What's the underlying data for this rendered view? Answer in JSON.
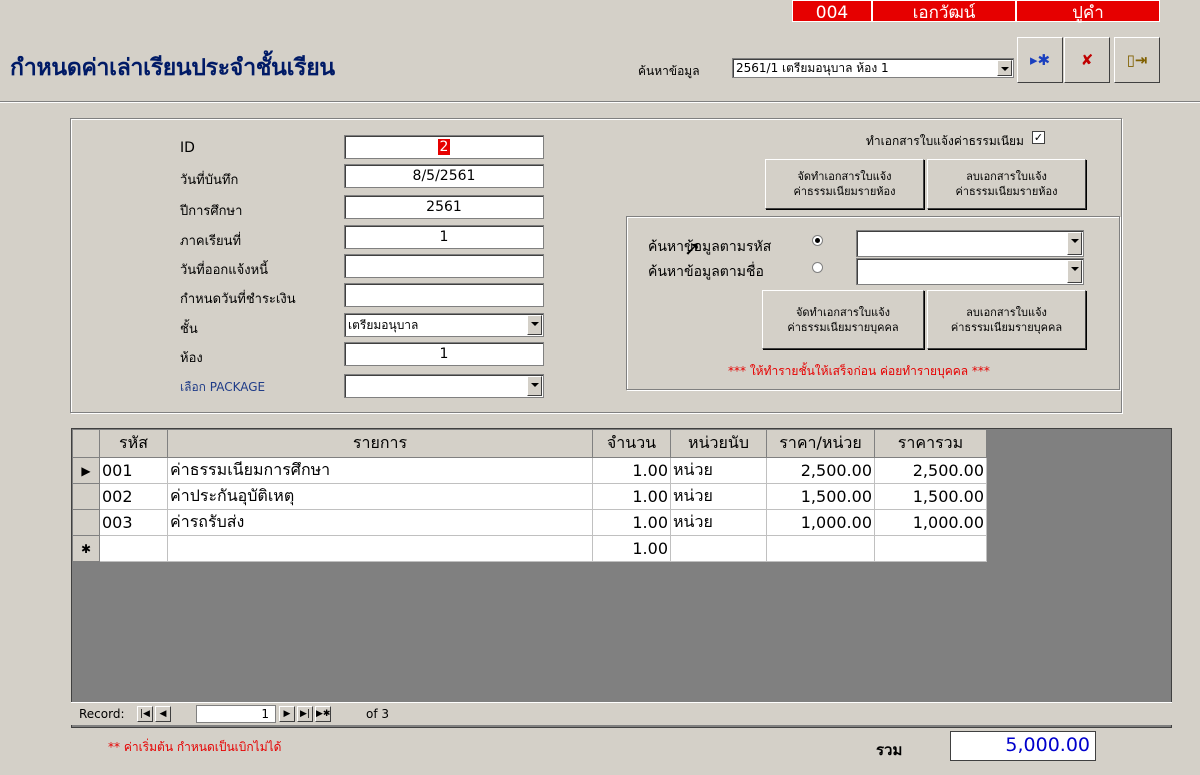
{
  "user_bar": {
    "code": "004",
    "first_name": "เอกวัฒน์",
    "last_name": "ปูคำ"
  },
  "page_title": "กำหนดค่าเล่าเรียนประจำชั้นเรียน",
  "search": {
    "label": "ค้นหาข้อมูล",
    "value": "2561/1 เตรียมอนุบาล  ห้อง  1"
  },
  "form": {
    "labels": {
      "id": "ID",
      "record_date": "วันที่บันทึก",
      "academic_year": "ปีการศึกษา",
      "semester": "ภาคเรียนที่",
      "issue_date": "วันที่ออกแจ้งหนี้",
      "due_date": "กำหนดวันที่ชำระเงิน",
      "level": "ชั้น",
      "room": "ห้อง",
      "package": "เลือก PACKAGE"
    },
    "values": {
      "id": "2",
      "record_date": "8/5/2561",
      "academic_year": "2561",
      "semester": "1",
      "issue_date": "",
      "due_date": "",
      "level": "เตรียมอนุบาล",
      "room": "1",
      "package": ""
    }
  },
  "right_panel": {
    "make_doc_label": "ทำเอกสารใบแจ้งค่าธรรมเนียม",
    "make_doc_checked": true,
    "btn_make_room": [
      "จัดทำเอกสารใบแจ้ง",
      "ค่าธรรมเนียมรายห้อง"
    ],
    "btn_delete_room": [
      "ลบเอกสารใบแจ้ง",
      "ค่าธรรมเนียมรายห้อง"
    ],
    "search_by_code": "ค้นหาข้อมูลตามรหัส",
    "search_by_name": "ค้นหาข้อมูลตามชื่อ",
    "btn_make_person": [
      "จัดทำเอกสารใบแจ้ง",
      "ค่าธรรมเนียมรายบุคคล"
    ],
    "btn_delete_person": [
      "ลบเอกสารใบแจ้ง",
      "ค่าธรรมเนียมรายบุคคล"
    ],
    "warning": "*** ให้ทำรายชั้นให้เสร็จก่อน ค่อยทำรายบุคคล ***"
  },
  "table": {
    "headers": [
      "รหัส",
      "รายการ",
      "จำนวน",
      "หน่วยนับ",
      "ราคา/หน่วย",
      "ราคารวม"
    ],
    "rows": [
      [
        "001",
        "ค่าธรรมเนียมการศึกษา",
        "1.00",
        "หน่วย",
        "2,500.00",
        "2,500.00"
      ],
      [
        "002",
        "ค่าประกันอุบัติเหตุ",
        "1.00",
        "หน่วย",
        "1,500.00",
        "1,500.00"
      ],
      [
        "003",
        "ค่ารถรับส่ง",
        "1.00",
        "หน่วย",
        "1,000.00",
        "1,000.00"
      ]
    ],
    "new_row_qty": "1.00"
  },
  "navigator": {
    "label": "Record:",
    "current": "1",
    "of_text": "of 3"
  },
  "footer": {
    "note": "** ค่าเริ่มต้น กำหนดเป็นเบิกไม่ได้",
    "total_label": "รวม",
    "total_value": "5,000.00"
  },
  "colors": {
    "user_bar": "#e60000",
    "title": "#001a66",
    "warning": "#e60000",
    "total": "#0000cc"
  }
}
